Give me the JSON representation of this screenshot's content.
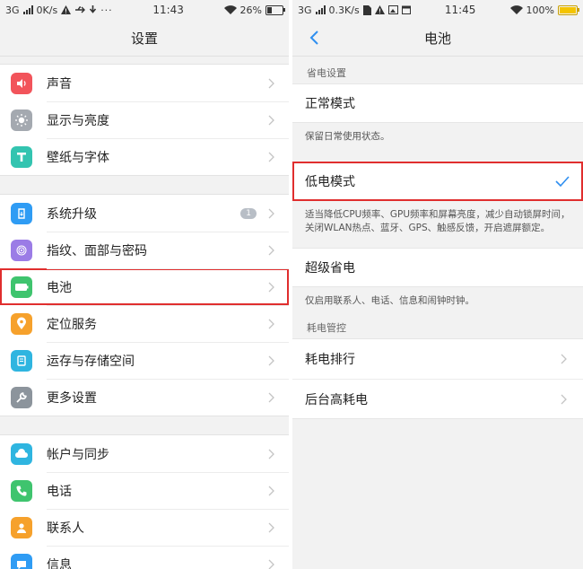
{
  "left": {
    "status": {
      "network": "3G",
      "speed": "0K/s",
      "time": "11:43",
      "battery": "26%",
      "battery_level": 0.26
    },
    "title": "设置",
    "groups": [
      [
        {
          "label": "声音",
          "icon": "speaker-icon",
          "color": "#f2545b"
        },
        {
          "label": "显示与亮度",
          "icon": "brightness-icon",
          "color": "#a4a9b0"
        },
        {
          "label": "壁纸与字体",
          "icon": "font-t-icon",
          "color": "#33c4b0"
        }
      ],
      [
        {
          "label": "系统升级",
          "icon": "system-update-icon",
          "color": "#2f9cf4",
          "badge": "1"
        },
        {
          "label": "指纹、面部与密码",
          "icon": "fingerprint-icon",
          "color": "#9b7ce6"
        },
        {
          "label": "电池",
          "icon": "battery-icon",
          "color": "#3fc46e"
        },
        {
          "label": "定位服务",
          "icon": "location-icon",
          "color": "#f6a12c"
        },
        {
          "label": "运存与存储空间",
          "icon": "storage-icon",
          "color": "#2fb5e0"
        },
        {
          "label": "更多设置",
          "icon": "wrench-icon",
          "color": "#8c949c"
        }
      ],
      [
        {
          "label": "帐户与同步",
          "icon": "account-sync-icon",
          "color": "#2fb5e0"
        },
        {
          "label": "电话",
          "icon": "phone-icon",
          "color": "#3fc46e"
        },
        {
          "label": "联系人",
          "icon": "contacts-icon",
          "color": "#f6a12c"
        },
        {
          "label": "信息",
          "icon": "message-icon",
          "color": "#2f9cf4"
        }
      ]
    ]
  },
  "right": {
    "status": {
      "network": "3G",
      "speed": "0.3K/s",
      "time": "11:45",
      "battery": "100%",
      "battery_level": 1.0
    },
    "title": "电池",
    "section_power_saving": "省电设置",
    "normal_mode": {
      "label": "正常模式",
      "desc": "保留日常使用状态。"
    },
    "low_power_mode": {
      "label": "低电模式",
      "desc": "适当降低CPU频率、GPU频率和屏幕亮度，减少自动锁屏时间，关闭WLAN热点、蓝牙、GPS、触感反馈，开启遮屏额定。"
    },
    "super_saving": {
      "label": "超级省电",
      "desc": "仅启用联系人、电话、信息和闹钟时钟。"
    },
    "section_power_usage": "耗电管控",
    "power_ranking": "耗电排行",
    "background_high_power": "后台高耗电",
    "colors": {
      "accent": "#2f8ff0",
      "highlight": "#e02e2e"
    }
  }
}
